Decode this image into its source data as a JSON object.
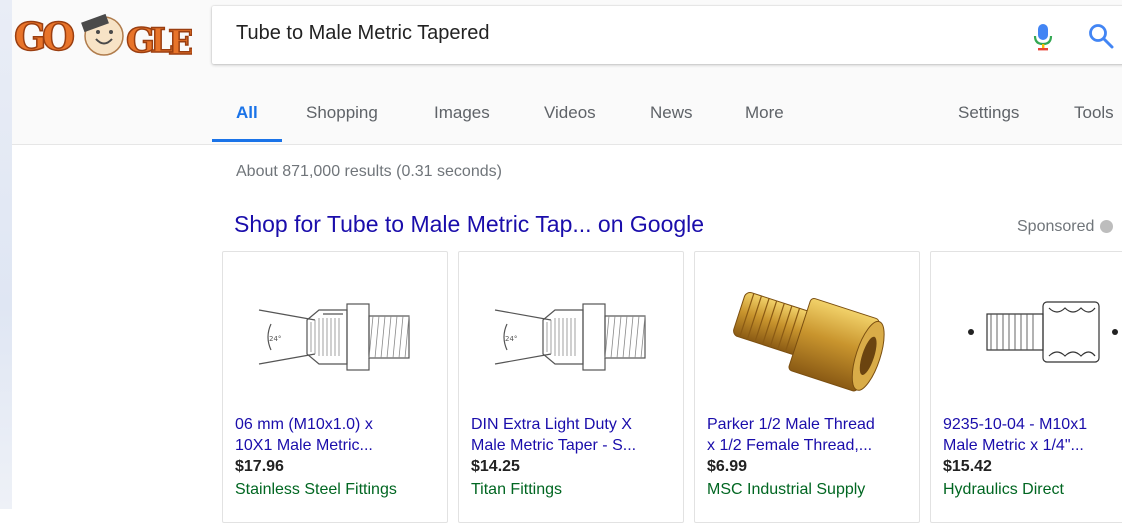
{
  "search": {
    "query": "Tube to Male Metric Tapered"
  },
  "doodle": {
    "letters": "GOOGLE",
    "colors": {
      "orange": "#e8742a",
      "cream": "#f7e3c6",
      "dark": "#4a4a4a"
    }
  },
  "tabs": [
    {
      "label": "All",
      "active": true
    },
    {
      "label": "Shopping",
      "active": false
    },
    {
      "label": "Images",
      "active": false
    },
    {
      "label": "Videos",
      "active": false
    },
    {
      "label": "News",
      "active": false
    },
    {
      "label": "More",
      "active": false
    },
    {
      "label": "Settings",
      "active": false
    },
    {
      "label": "Tools",
      "active": false
    }
  ],
  "result_stats": "About 871,000 results (0.31 seconds)",
  "shopping": {
    "title": "Shop for Tube to Male Metric Tap... on Google",
    "sponsored_label": "Sponsored",
    "products": [
      {
        "title_line1": "06 mm (M10x1.0) x",
        "title_line2": "10X1 Male Metric...",
        "price": "$17.96",
        "seller": "Stainless Steel Fittings",
        "image_icon": "tube-fitting-drawing-icon"
      },
      {
        "title_line1": "DIN Extra Light Duty X",
        "title_line2": "Male Metric Taper - S...",
        "price": "$14.25",
        "seller": "Titan Fittings",
        "image_icon": "tube-fitting-drawing-icon"
      },
      {
        "title_line1": "Parker 1/2 Male Thread",
        "title_line2": "x 1/2 Female Thread,...",
        "price": "$6.99",
        "seller": "MSC Industrial Supply",
        "image_icon": "brass-adapter-icon"
      },
      {
        "title_line1": "9235-10-04 - M10x1",
        "title_line2": "Male Metric x 1/4\"...",
        "price": "$15.42",
        "seller": "Hydraulics Direct",
        "image_icon": "fitting-schematic-icon"
      }
    ]
  },
  "colors": {
    "accent_blue": "#1a73e8",
    "link": "#1a0dab",
    "seller_green": "#006621",
    "mic_blue": "#4285f4",
    "mic_red": "#ea4335",
    "mic_yellow": "#fbbc05",
    "mic_green": "#34a853"
  }
}
